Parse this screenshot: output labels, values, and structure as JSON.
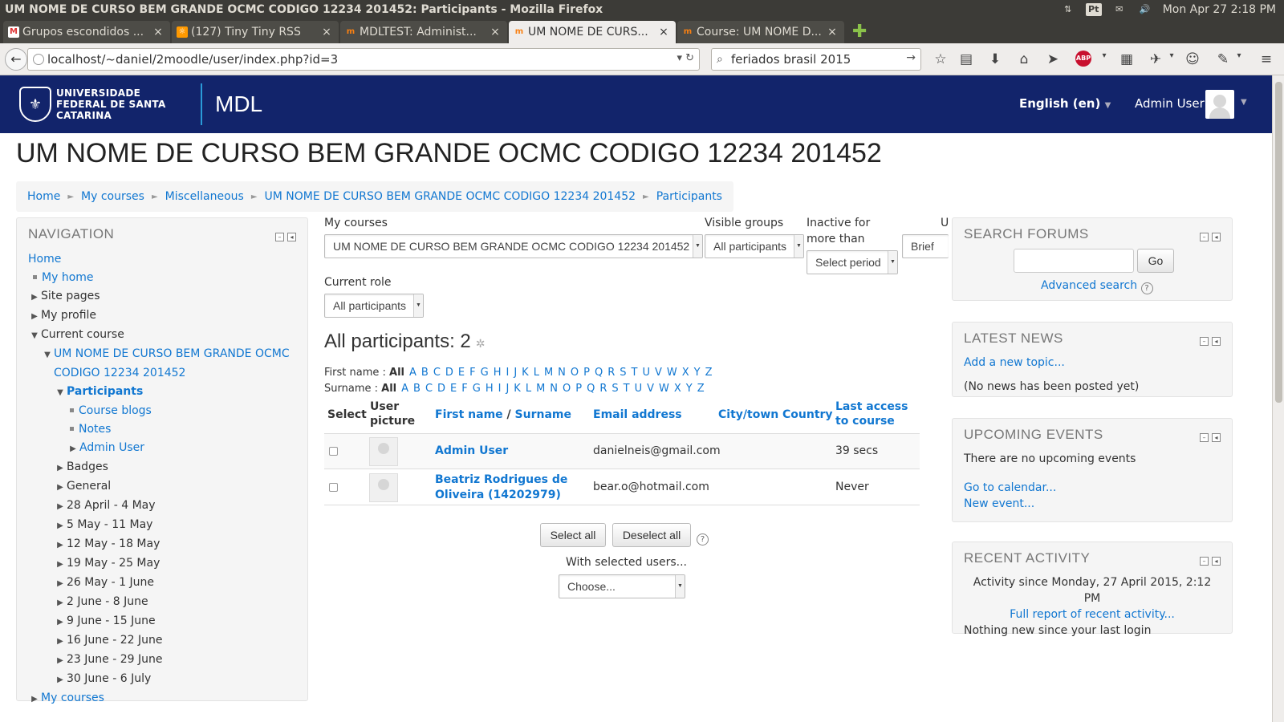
{
  "window": {
    "title": "UM NOME DE CURSO BEM GRANDE OCMC CODIGO 12234 201452: Participants - Mozilla Firefox",
    "indicator_lang": "Pt",
    "clock": "Mon Apr 27  2:18 PM"
  },
  "tabs": [
    {
      "label": "Grupos escondidos ...",
      "icon": "gmail-icon",
      "active": false
    },
    {
      "label": "(127) Tiny Tiny RSS",
      "icon": "rss-icon",
      "active": false
    },
    {
      "label": "MDLTEST: Administ...",
      "icon": "moodle-icon",
      "active": false
    },
    {
      "label": "UM NOME DE CURS...",
      "icon": "moodle-icon",
      "active": true
    },
    {
      "label": "Course: UM NOME D...",
      "icon": "moodle-icon",
      "active": false
    }
  ],
  "browser": {
    "url": "localhost/~daniel/2moodle/user/index.php?id=3",
    "search_value": "feriados brasil 2015"
  },
  "header": {
    "university": "UNIVERSIDADE FEDERAL DE SANTA CATARINA",
    "site_name": "MDL",
    "language": "English (en)",
    "user": "Admin User"
  },
  "page": {
    "title": "UM NOME DE CURSO BEM GRANDE OCMC CODIGO 12234 201452",
    "breadcrumb": [
      "Home",
      "My courses",
      "Miscellaneous",
      "UM NOME DE CURSO BEM GRANDE OCMC CODIGO 12234 201452",
      "Participants"
    ]
  },
  "navigation": {
    "title": "NAVIGATION",
    "home": "Home",
    "my_home": "My home",
    "site_pages": "Site pages",
    "my_profile": "My profile",
    "current_course": "Current course",
    "course_name_line1": "UM NOME DE CURSO BEM GRANDE OCMC",
    "course_name_line2": "CODIGO 12234 201452",
    "participants": "Participants",
    "course_blogs": "Course blogs",
    "notes": "Notes",
    "admin_user": "Admin User",
    "badges": "Badges",
    "general": "General",
    "weeks": [
      "28 April - 4 May",
      "5 May - 11 May",
      "12 May - 18 May",
      "19 May - 25 May",
      "26 May - 1 June",
      "2 June - 8 June",
      "9 June - 15 June",
      "16 June - 22 June",
      "23 June - 29 June",
      "30 June - 6 July"
    ],
    "my_courses": "My courses"
  },
  "filters": {
    "my_courses_label": "My courses",
    "my_courses_value": "UM NOME DE CURSO BEM GRANDE OCMC CODIGO 12234 201452",
    "visible_groups_label": "Visible groups",
    "visible_groups_value": "All participants",
    "inactive_label_1": "Inactive for",
    "inactive_label_2": "more than",
    "inactive_value": "Select period",
    "user_list_label": "Us",
    "user_list_value": "Brief",
    "current_role_label": "Current role",
    "current_role_value": "All participants"
  },
  "participants": {
    "heading": "All participants: 2",
    "firstname_label": "First name :",
    "surname_label": "Surname :",
    "all": "All",
    "letters": [
      "A",
      "B",
      "C",
      "D",
      "E",
      "F",
      "G",
      "H",
      "I",
      "J",
      "K",
      "L",
      "M",
      "N",
      "O",
      "P",
      "Q",
      "R",
      "S",
      "T",
      "U",
      "V",
      "W",
      "X",
      "Y",
      "Z"
    ],
    "columns": {
      "select": "Select",
      "picture_1": "User",
      "picture_2": "picture",
      "firstname": "First name",
      "slash": "/",
      "surname": "Surname",
      "email": "Email address",
      "city": "City/town",
      "country": "Country",
      "lastaccess_1": "Last access",
      "lastaccess_2": "to course"
    },
    "rows": [
      {
        "name_1": "Admin User",
        "name_2": "",
        "email": "danielneis@gmail.com",
        "last_access": "39 secs"
      },
      {
        "name_1": "Beatriz Rodrigues de",
        "name_2": "Oliveira (14202979)",
        "email": "bear.o@hotmail.com",
        "last_access": "Never"
      }
    ],
    "select_all": "Select all",
    "deselect_all": "Deselect all",
    "with_selected": "With selected users...",
    "choose": "Choose..."
  },
  "search_forums": {
    "title": "SEARCH FORUMS",
    "input_value": "",
    "go": "Go",
    "advanced": "Advanced search"
  },
  "latest_news": {
    "title": "LATEST NEWS",
    "add_topic": "Add a new topic...",
    "empty": "(No news has been posted yet)"
  },
  "upcoming_events": {
    "title": "UPCOMING EVENTS",
    "empty": "There are no upcoming events",
    "calendar": "Go to calendar...",
    "new_event": "New event..."
  },
  "recent_activity": {
    "title": "RECENT ACTIVITY",
    "since": "Activity since Monday, 27 April 2015, 2:12 PM",
    "full_report": "Full report of recent activity...",
    "nothing": "Nothing new since your last login"
  }
}
